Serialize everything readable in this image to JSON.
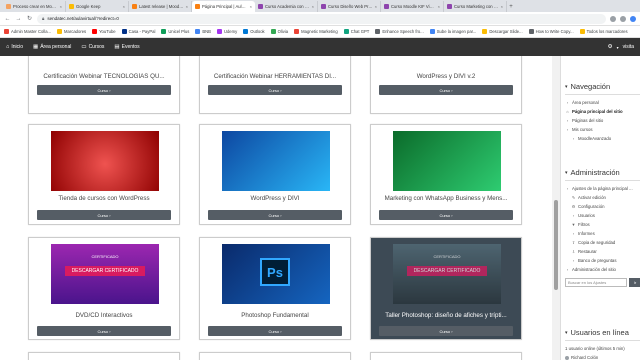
{
  "tabs": [
    {
      "label": "Proceso crear en Moodle",
      "color": "#f4a261"
    },
    {
      "label": "Google Keep",
      "color": "#fbbc04"
    },
    {
      "label": "Latest release | Moodle downl",
      "color": "#f98012"
    },
    {
      "label": "Página Principal | Aula Vi",
      "color": "#f98012"
    },
    {
      "label": "Curso Academia con WordPr",
      "color": "#8e44ad"
    },
    {
      "label": "Curso Diseño Web Profesion",
      "color": "#8e44ad"
    },
    {
      "label": "Curso Moodle KIF Video tut",
      "color": "#8e44ad"
    },
    {
      "label": "Curso Marketing con Whats",
      "color": "#8e44ad"
    }
  ],
  "address": {
    "url": "sendatec.net/aulavirtual/?redirect=0"
  },
  "bookmarks": [
    {
      "label": "Admin Master Colla...",
      "color": "#ea4335"
    },
    {
      "label": "Marcadores",
      "color": "#fbbc04"
    },
    {
      "label": "YouTube",
      "color": "#ff0000"
    },
    {
      "label": "Casa - PayPal",
      "color": "#003087"
    },
    {
      "label": "Unicel Plus",
      "color": "#0f9d58"
    },
    {
      "label": "BNB",
      "color": "#4285f4"
    },
    {
      "label": "Udemy",
      "color": "#a435f0"
    },
    {
      "label": "Outlook",
      "color": "#0078d4"
    },
    {
      "label": "Olivia",
      "color": "#34a853"
    },
    {
      "label": "Magnetic Marketing",
      "color": "#ea4335"
    },
    {
      "label": "Chat GPT",
      "color": "#10a37f"
    },
    {
      "label": "Enhance Speech fro...",
      "color": "#5f6368"
    },
    {
      "label": "Sube la imagen par...",
      "color": "#4285f4"
    },
    {
      "label": "Descargar Slide...",
      "color": "#fbbc04"
    },
    {
      "label": "How to Write Copy...",
      "color": "#5f6368"
    },
    {
      "label": "Todos los marcadores",
      "color": "#fbbc04"
    }
  ],
  "header": {
    "nav": [
      {
        "label": "Inicio",
        "icon": "home-icon"
      },
      {
        "label": "Área personal",
        "icon": "dashboard-icon"
      },
      {
        "label": "Cursos",
        "icon": "courses-icon"
      },
      {
        "label": "Eventos",
        "icon": "calendar-icon"
      }
    ],
    "user": "visita"
  },
  "cards": [
    {
      "title": "Certificación Webinar TECNOLOGÍAS QU...",
      "button": "Curso ›",
      "bg": "#f6b100"
    },
    {
      "title": "Certificación Webinar HERRAMIENTAS DI...",
      "button": "Curso ›",
      "bg": "#222"
    },
    {
      "title": "WordPress y DIVI v.2",
      "button": "Curso ›",
      "bg": "#1565c0"
    },
    {
      "title": "Tienda de cursos con WordPress",
      "button": "Curso ›",
      "bg": "#c62828"
    },
    {
      "title": "WordPress y DIVI",
      "button": "Curso ›",
      "bg": "#1565c0"
    },
    {
      "title": "Marketing con WhatsApp Business y Mens...",
      "button": "Curso ›",
      "bg": "#1b8a3a"
    },
    {
      "title": "DVD/CD Interactivos",
      "button": "Curso ›",
      "bg": "#7b1fa2"
    },
    {
      "title": "Photoshop Fundamental",
      "button": "Curso ›",
      "bg": "#0d47a1"
    },
    {
      "title": "Taller Photoshop: diseño de afiches y trípti...",
      "button": "Curso ›",
      "bg": "#37474f"
    }
  ],
  "card_art": {
    "certificado_label": "CERTIFICADO",
    "descargar_label": "DESCARGAR CERTIFICADO",
    "ps_label": "Ps"
  },
  "sidebar": {
    "navegacion": {
      "title": "Navegación",
      "items": [
        {
          "label": "Área personal",
          "level": 0,
          "bold": false,
          "icon": "chevron-icon"
        },
        {
          "label": "Página principal del sitio",
          "level": 0,
          "bold": true,
          "icon": "home-icon"
        },
        {
          "label": "Páginas del sitio",
          "level": 0,
          "bold": false,
          "icon": "chevron-icon"
        },
        {
          "label": "Mis cursos",
          "level": 0,
          "bold": false,
          "icon": "chevron-icon"
        },
        {
          "label": "MoodleAvanzado",
          "level": 1,
          "bold": false,
          "icon": "chevron-icon"
        }
      ]
    },
    "administracion": {
      "title": "Administración",
      "items": [
        {
          "label": "Ajustes de la página principal ...",
          "level": 0,
          "icon": "chevron-icon"
        },
        {
          "label": "Activar edición",
          "level": 1,
          "icon": "pencil-icon"
        },
        {
          "label": "Configuración",
          "level": 1,
          "icon": "gear-icon"
        },
        {
          "label": "Usuarios",
          "level": 1,
          "icon": "chevron-icon"
        },
        {
          "label": "Filtros",
          "level": 1,
          "icon": "filter-icon"
        },
        {
          "label": "Informes",
          "level": 1,
          "icon": "chevron-icon"
        },
        {
          "label": "Copia de seguridad",
          "level": 1,
          "icon": "backup-icon"
        },
        {
          "label": "Restaurar",
          "level": 1,
          "icon": "restore-icon"
        },
        {
          "label": "Banco de preguntas",
          "level": 1,
          "icon": "chevron-icon"
        },
        {
          "label": "Administración del sitio",
          "level": 0,
          "icon": "chevron-icon"
        }
      ],
      "search_placeholder": "Buscar en los Ajustes",
      "search_button": "Ir"
    },
    "usuarios": {
      "title": "Usuarios en línea",
      "line": "1 usuario online (últimos 5 min)",
      "user": "Richard Colón"
    }
  }
}
